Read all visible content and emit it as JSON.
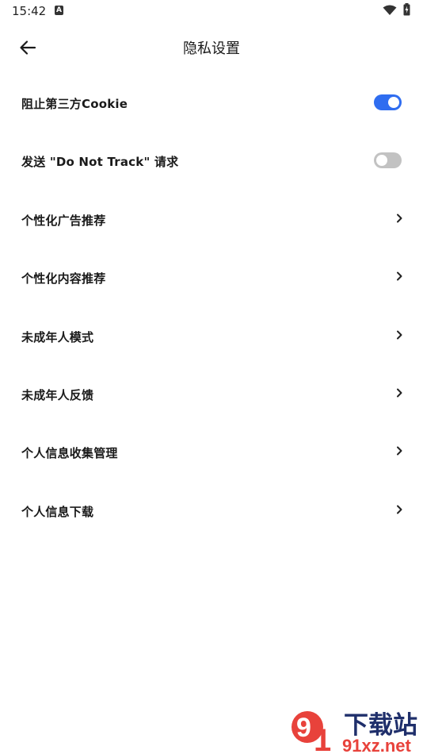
{
  "status_bar": {
    "time": "15:42",
    "notification_badge": "A",
    "icons": [
      "wifi-icon",
      "battery-icon"
    ]
  },
  "header": {
    "title": "隐私设置",
    "back_icon": "arrow-left-icon"
  },
  "settings": {
    "block_cookie": {
      "label": "阻止第三方Cookie",
      "control": "toggle",
      "state": "on"
    },
    "do_not_track": {
      "label": "发送 \"Do Not Track\" 请求",
      "control": "toggle",
      "state": "off"
    },
    "personalized_ads": {
      "label": "个性化广告推荐",
      "control": "chevron"
    },
    "personalized_content": {
      "label": "个性化内容推荐",
      "control": "chevron"
    },
    "minor_mode": {
      "label": "未成年人模式",
      "control": "chevron"
    },
    "minor_feedback": {
      "label": "未成年人反馈",
      "control": "chevron"
    },
    "info_collection": {
      "label": "个人信息收集管理",
      "control": "chevron"
    },
    "info_download": {
      "label": "个人信息下载",
      "control": "chevron"
    }
  },
  "colors": {
    "toggle_on": "#2f6df0",
    "toggle_off": "#c2c2c2",
    "watermark_red": "#e8423b",
    "watermark_blue": "#1f2f6b"
  },
  "watermark": {
    "text_top": "下载站",
    "text_bottom": "91xz.net"
  }
}
